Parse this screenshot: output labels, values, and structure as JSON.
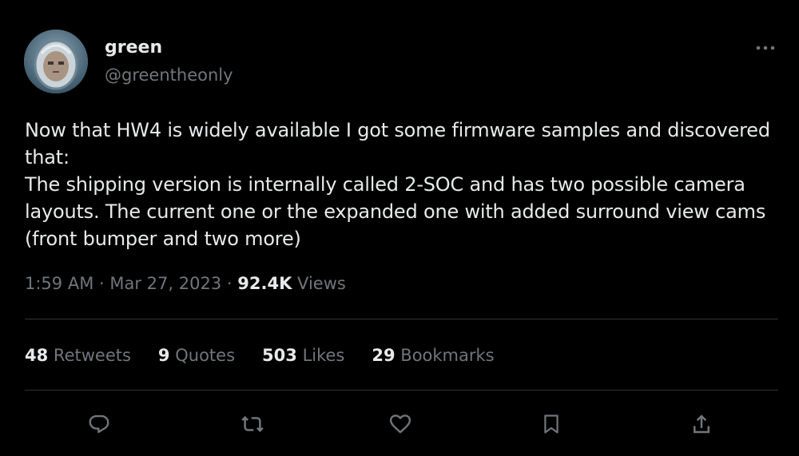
{
  "author": {
    "display_name": "green",
    "handle": "@greentheonly",
    "avatar_icon": "astronaut-helmet-avatar"
  },
  "more_icon": "more-horizontal-icon",
  "tweet": {
    "text": "Now that HW4 is widely available I got some firmware samples and discovered that:\nThe shipping version is internally called 2-SOC and has two possible camera layouts. The current one or the expanded one with added surround view cams (front bumper and two more)"
  },
  "meta": {
    "time": "1:59 AM",
    "separator1": "·",
    "date": "Mar 27, 2023",
    "separator2": "·",
    "views_count": "92.4K",
    "views_label": "Views"
  },
  "stats": {
    "retweets": {
      "count": "48",
      "label": "Retweets"
    },
    "quotes": {
      "count": "9",
      "label": "Quotes"
    },
    "likes": {
      "count": "503",
      "label": "Likes"
    },
    "bookmarks": {
      "count": "29",
      "label": "Bookmarks"
    }
  },
  "actions": [
    {
      "name": "reply",
      "icon": "reply-icon"
    },
    {
      "name": "retweet",
      "icon": "retweet-icon"
    },
    {
      "name": "like",
      "icon": "heart-icon"
    },
    {
      "name": "bookmark",
      "icon": "bookmark-icon"
    },
    {
      "name": "share",
      "icon": "share-icon"
    }
  ],
  "colors": {
    "background": "#000000",
    "text_primary": "#e7e9ea",
    "text_secondary": "#71767b",
    "divider": "#2f3336"
  }
}
